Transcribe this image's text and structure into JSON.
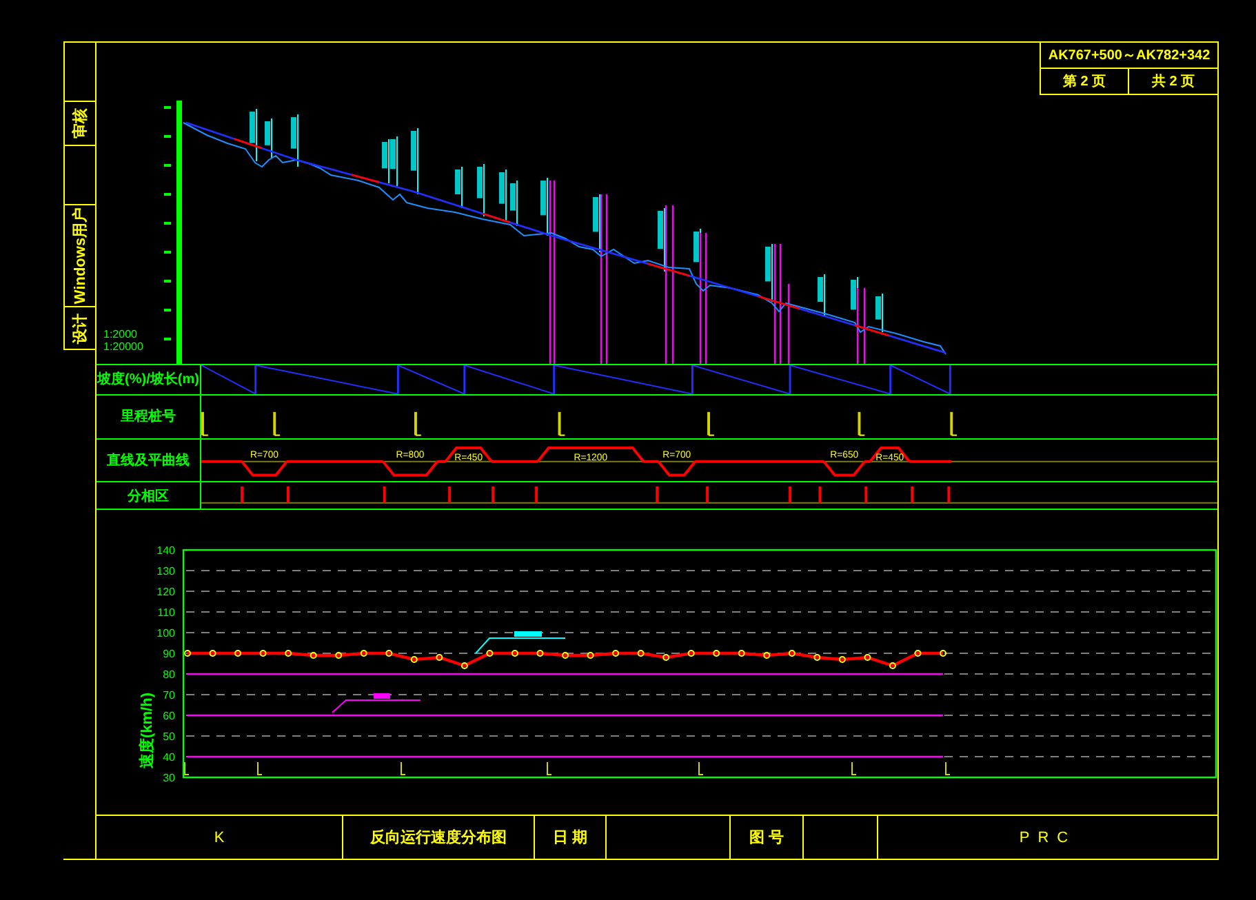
{
  "sign_off_strip": {
    "items": [
      {
        "label": "审核"
      },
      {
        "label": "Windows用户"
      },
      {
        "label": "设计"
      }
    ]
  },
  "sheet_info": {
    "range": "AK767+500～AK782+342",
    "page": "第 2 页",
    "total": "共 2 页"
  },
  "profile": {
    "scales": [
      "1:2000",
      "1:20000"
    ]
  },
  "table": {
    "rows": [
      {
        "kind": "slope",
        "label": "坡度(%)/坡长(m)"
      },
      {
        "kind": "mileage",
        "label": "里程桩号"
      },
      {
        "kind": "curves",
        "label": "直线及平曲线",
        "curves": [
          {
            "label": "R=700",
            "kind": "down"
          },
          {
            "label": "R=800",
            "kind": "down"
          },
          {
            "label": "R=450",
            "kind": "up"
          },
          {
            "label": "R=1200",
            "kind": "up"
          },
          {
            "label": "R=700",
            "kind": "down"
          },
          {
            "label": "R=650",
            "kind": "down"
          },
          {
            "label": "R=450",
            "kind": "up"
          }
        ]
      },
      {
        "kind": "phase",
        "label": "分相区"
      }
    ]
  },
  "speed_chart": {
    "chart_data": {
      "type": "line",
      "ylabel": "速度(km/h)",
      "categories": [
        null,
        null,
        null,
        null,
        null,
        null,
        null,
        null,
        null,
        null,
        null,
        null,
        null,
        null,
        null,
        null,
        null,
        null,
        null,
        null,
        null,
        null,
        null,
        null,
        null,
        null,
        null,
        null,
        null,
        null,
        null
      ],
      "ylim": [
        30,
        140
      ],
      "grid": true,
      "yticks": [
        30,
        40,
        50,
        60,
        70,
        80,
        90,
        100,
        110,
        120,
        130,
        140
      ],
      "series": [
        {
          "color": "#ff0000",
          "marker": "o",
          "values": [
            90,
            90,
            90,
            90,
            90,
            89,
            89,
            90,
            90,
            87,
            88,
            84,
            90,
            90,
            90,
            89,
            89,
            90,
            90,
            88,
            90,
            90,
            90,
            89,
            90,
            88,
            87,
            88,
            84,
            90,
            90
          ]
        },
        {
          "color": "#ff00ff",
          "values": [
            80,
            80,
            80,
            80,
            80,
            80,
            80,
            80,
            80,
            80,
            80,
            80,
            80,
            80,
            80,
            80,
            80,
            80,
            80,
            80,
            80,
            80,
            80,
            80,
            80,
            80,
            80,
            80,
            80,
            80,
            80
          ]
        },
        {
          "color": "#ff00ff",
          "values": [
            60,
            60,
            60,
            60,
            60,
            60,
            60,
            60,
            60,
            60,
            60,
            60,
            60,
            60,
            60,
            60,
            60,
            60,
            60,
            60,
            60,
            60,
            60,
            60,
            60,
            60,
            60,
            60,
            60,
            60,
            60
          ]
        },
        {
          "color": "#ff00ff",
          "values": [
            40,
            40,
            40,
            40,
            40,
            40,
            40,
            40,
            40,
            40,
            40,
            40,
            40,
            40,
            40,
            40,
            40,
            40,
            40,
            40,
            40,
            40,
            40,
            40,
            40,
            40,
            40,
            40,
            40,
            40,
            40
          ]
        }
      ]
    }
  },
  "title_block": {
    "drawing_id": "K",
    "title": "反向运行速度分布图",
    "date_label": "日 期",
    "drawing_no_label": "图 号",
    "code": "PRC"
  }
}
